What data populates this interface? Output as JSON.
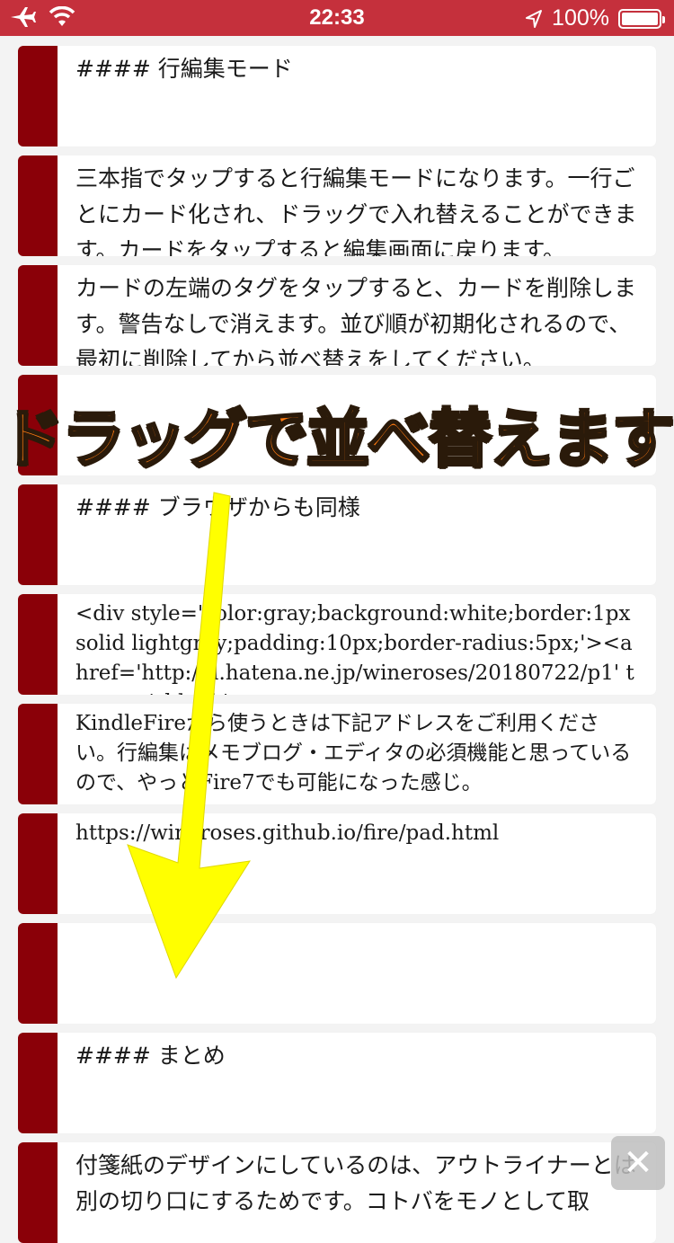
{
  "status_bar": {
    "time": "22:33",
    "battery_text": "100%",
    "battery_level": 1.0,
    "icons": [
      "airplane-icon",
      "wifi-icon",
      "location-arrow-icon",
      "battery-icon"
    ]
  },
  "cards": [
    {
      "text": "#### 行編集モード"
    },
    {
      "text": "三本指でタップすると行編集モードになります。一行ごとにカード化され、ドラッグで入れ替えることができます。カードをタップすると編集画面に戻ります。"
    },
    {
      "text": "カードの左端のタグをタップすると、カードを削除します。警告なしで消えます。並び順が初期化されるので、最初に削除してから並べ替えをしてください。"
    },
    {
      "text": ""
    },
    {
      "text": "#### ブラウザからも同様"
    },
    {
      "text": "<div style='color:gray;background:white;border:1px solid lightgray;padding:10px;border-radius:5px;'><a href='http://d.hatena.ne.jp/wineroses/20180722/p1' target='_blank'>"
    },
    {
      "text": "KindleFireから使うときは下記アドレスをご利用ください。行編集はメモブログ・エディタの必須機能と思っているので、やっとFire7でも可能になった感じ。"
    },
    {
      "text": "https://wineroses.github.io/fire/pad.html"
    },
    {
      "text": ""
    },
    {
      "text": "#### まとめ"
    },
    {
      "text": "付箋紙のデザインにしているのは、アウトライナーとは別の切り口にするためです。コトバをモノとして取"
    }
  ],
  "overlay": {
    "caption": "ドラッグで並べ替えます",
    "caption_color": "#ff7a10",
    "arrow_color": "#ffff00"
  },
  "close_button": {
    "icon": "close-icon",
    "glyph": "✕"
  },
  "colors": {
    "status_bar": "#c5303c",
    "tag": "#8a0008",
    "background": "#f3f3f3"
  }
}
